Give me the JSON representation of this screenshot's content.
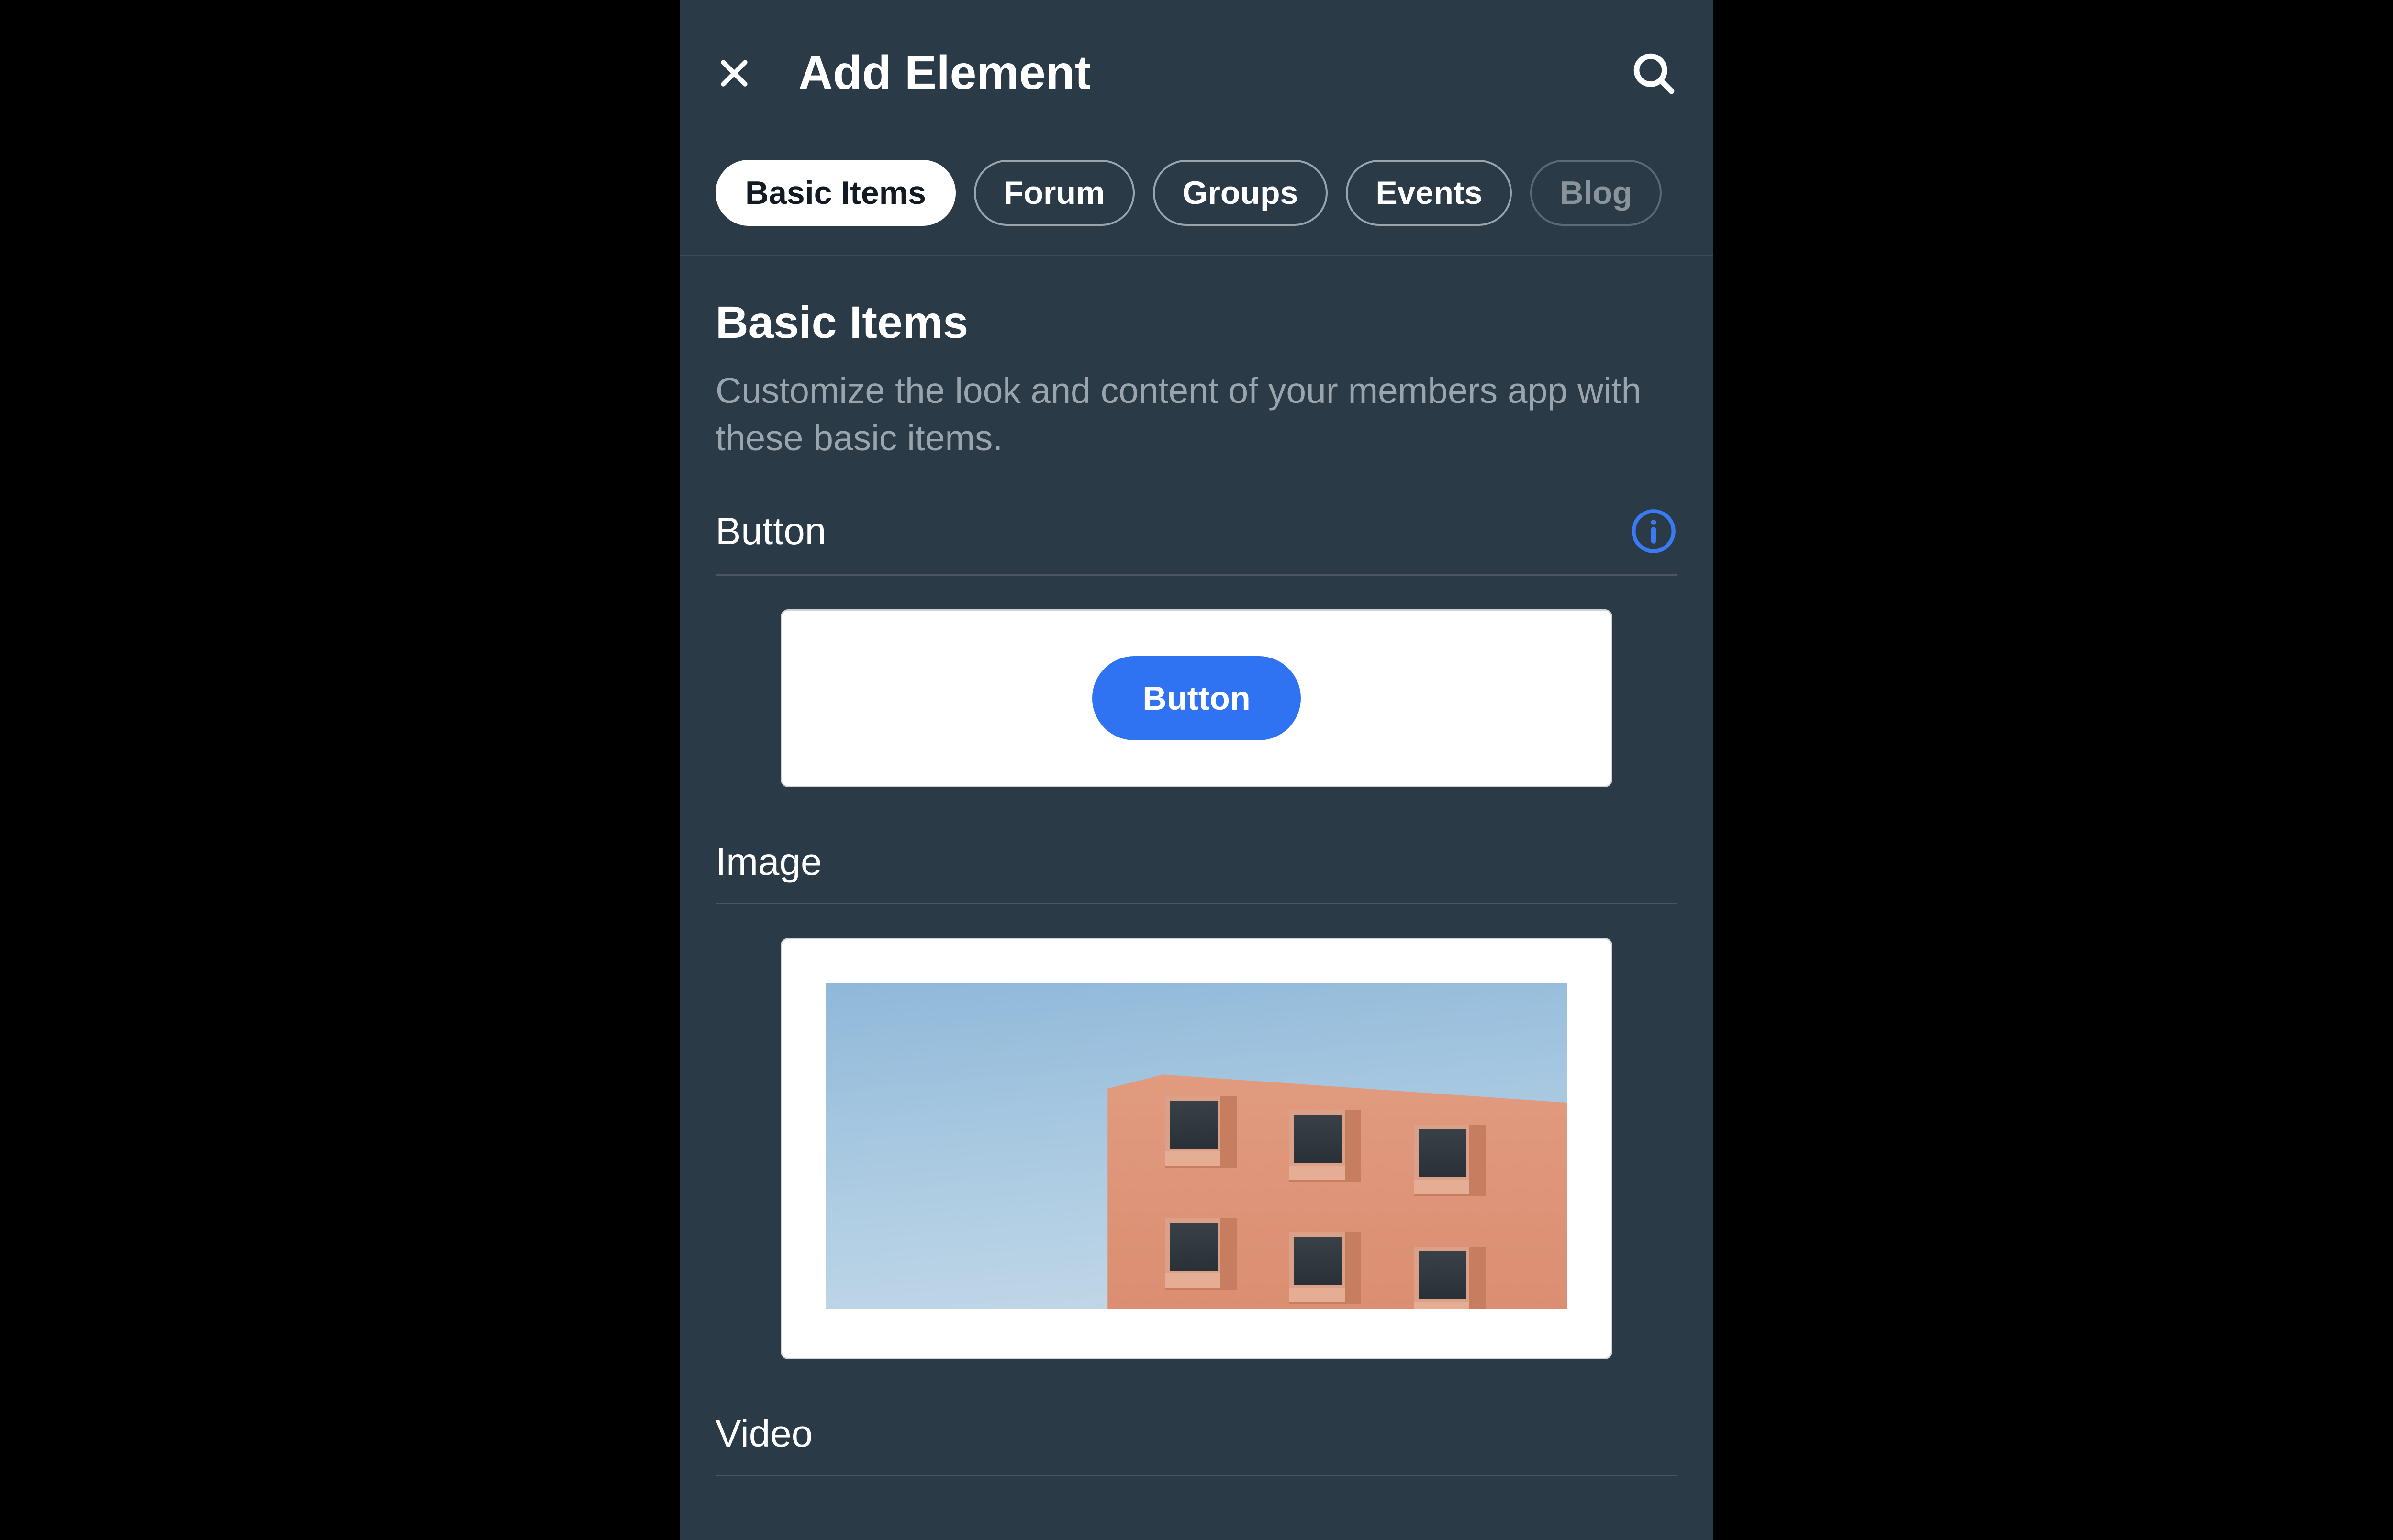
{
  "header": {
    "title": "Add Element"
  },
  "tabs": [
    {
      "label": "Basic Items",
      "active": true
    },
    {
      "label": "Forum",
      "active": false
    },
    {
      "label": "Groups",
      "active": false
    },
    {
      "label": "Events",
      "active": false
    },
    {
      "label": "Blog",
      "active": false,
      "faded": true
    }
  ],
  "section": {
    "title": "Basic Items",
    "description": "Customize the look and content of your members app with these basic items."
  },
  "items": {
    "button": {
      "label": "Button",
      "sample_label": "Button"
    },
    "image": {
      "label": "Image"
    },
    "video": {
      "label": "Video"
    }
  },
  "icons": {
    "close": "close-icon",
    "search": "search-icon",
    "info": "info-icon"
  },
  "colors": {
    "background": "#2a3a47",
    "accent": "#2f72f2",
    "text_primary": "#ffffff",
    "text_secondary": "#9aa4ac"
  }
}
